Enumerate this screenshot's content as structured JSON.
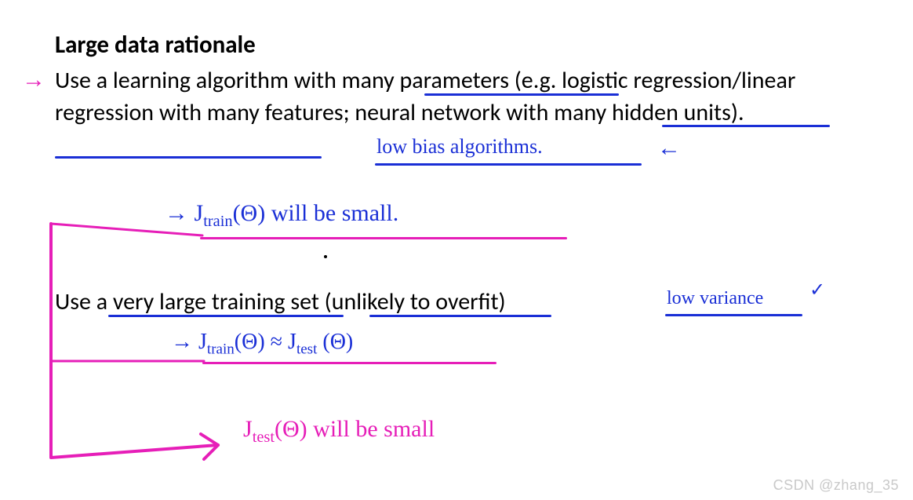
{
  "slide": {
    "title": "Large data rationale",
    "para1": "Use a learning algorithm with many parameters (e.g. logistic regression/linear regression with many features; neural network with many hidden units).",
    "para2": "Use a very large training set (unlikely to overfit)"
  },
  "annotations": {
    "low_bias": "low  bias  algorithms.",
    "jtrain_small_prefix": "→  J",
    "jtrain_small_sub": "train",
    "jtrain_small_theta": "(Θ)",
    "jtrain_small_suffix": "  will  be  small.",
    "low_variance": "low  variance",
    "equiv_prefix": "→  J",
    "equiv_sub1": "train",
    "equiv_mid": "(Θ) ≈  J",
    "equiv_sub2": "test",
    "equiv_end": " (Θ)",
    "jtest_small_prefix": "J",
    "jtest_small_sub": "test",
    "jtest_small_theta": "(Θ)",
    "jtest_small_suffix": "  will  be  small",
    "arrow_left": "→",
    "arrow_right": "←",
    "check": "✓"
  },
  "watermark": "CSDN @zhang_35"
}
